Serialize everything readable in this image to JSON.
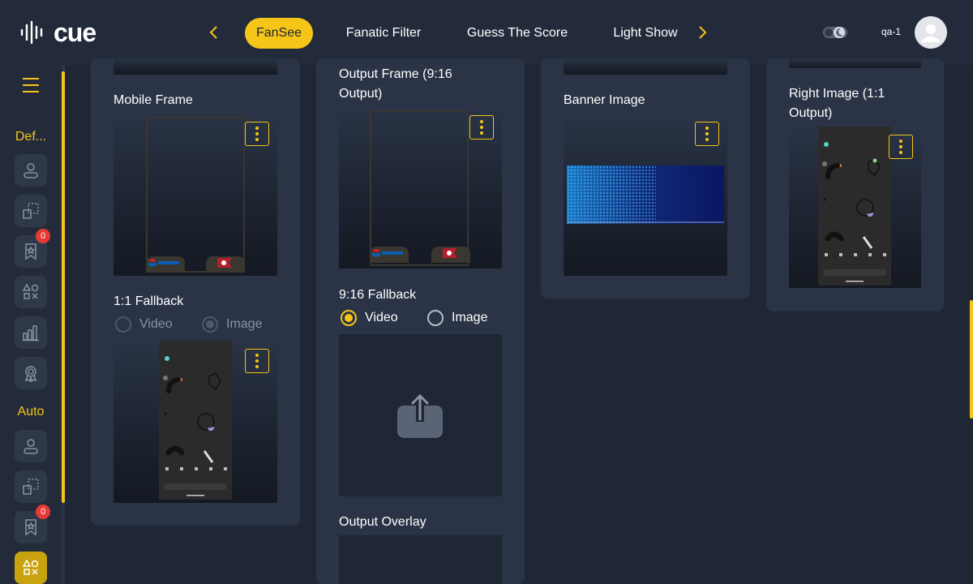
{
  "header": {
    "brand": "cue",
    "tabs": [
      {
        "label": "FanSee"
      },
      {
        "label": "Fanatic Filter"
      },
      {
        "label": "Guess The Score"
      },
      {
        "label": "Light Show"
      }
    ],
    "prev_icon": "chevron-left-icon",
    "next_icon": "chevron-right-icon",
    "theme_icon": "dark-mode-toggle-icon",
    "user_name": "qa-1",
    "accent": "#f5c518"
  },
  "sidebar": {
    "groups": [
      {
        "label": "Def...",
        "items": [
          {
            "icon": "user-icon"
          },
          {
            "icon": "layers-icon"
          },
          {
            "icon": "bookmark-star-icon",
            "badge": "0"
          },
          {
            "icon": "shapes-icon"
          },
          {
            "icon": "bar-chart-icon"
          },
          {
            "icon": "award-icon"
          }
        ]
      },
      {
        "label": "Auto",
        "items": [
          {
            "icon": "user-icon"
          },
          {
            "icon": "layers-icon"
          },
          {
            "icon": "bookmark-star-icon",
            "badge": "0"
          },
          {
            "icon": "shapes-icon"
          }
        ]
      }
    ]
  },
  "main": {
    "col1": {
      "mobile_frame_label": "Mobile Frame",
      "fallback_label": "1:1 Fallback",
      "fallback_options": [
        "Video",
        "Image"
      ],
      "fallback_selected": "Image"
    },
    "col2": {
      "output_frame_label": "Output Frame (9:16 Output)",
      "fallback_label": "9:16 Fallback",
      "fallback_options": [
        "Video",
        "Image"
      ],
      "fallback_selected": "Video",
      "upload_icon": "upload-icon",
      "overlay_label": "Output Overlay"
    },
    "col3": {
      "banner_label": "Banner Image"
    },
    "col4": {
      "right_image_label": "Right Image (1:1 Output)"
    }
  }
}
